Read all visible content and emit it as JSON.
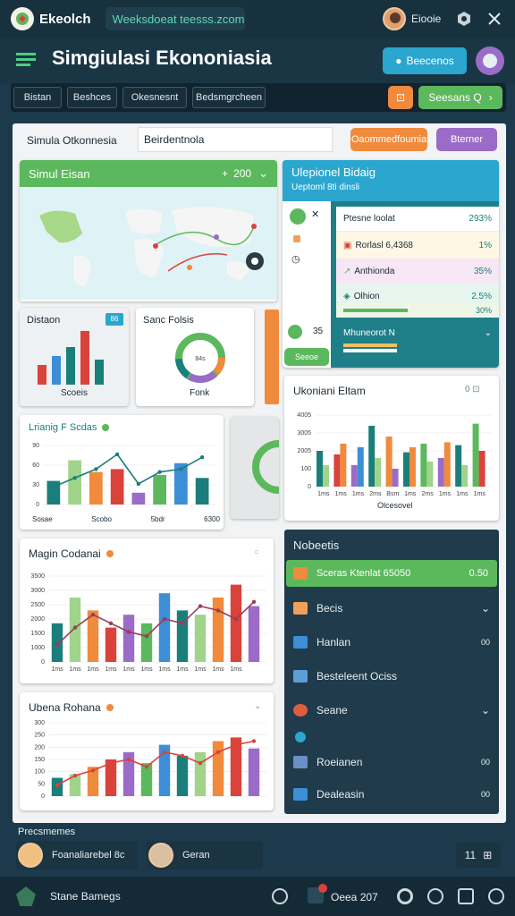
{
  "topbar": {
    "app_name": "Ekeolch",
    "url_text": "Weeksdoeat teesss.zcom",
    "user_name": "Eiooie"
  },
  "header": {
    "title": "Simgiulasi Ekononiasia",
    "btn_primary": "Beecenos",
    "nav_tabs": [
      "Bistan",
      "Beshces",
      "Okesnesnt",
      "Bedsmgrcheen"
    ],
    "nav_btn": "Seesans Q"
  },
  "sim": {
    "label": "Simula Otkonnesia",
    "input_value": "Beirdentnola",
    "btn_orange": "Oaommedfoumia",
    "btn_purple": "Bterner"
  },
  "map_card": {
    "title": "Simul Eisan",
    "value": "200"
  },
  "right_card": {
    "title": "Ulepionel Bidaig",
    "subtitle": "Ueptoml 8ti dinsli",
    "rows": [
      {
        "label": "Ptesne loolat",
        "value": "293%",
        "bg": "#ffffff"
      },
      {
        "label": "Rorlasl 6,4368",
        "value": "1%",
        "bg": "#fdf7e4"
      },
      {
        "label": "Anthionda",
        "value": "35%",
        "bg": "#f7e6f4"
      },
      {
        "label": "Olhion",
        "value": "2.5%",
        "bg": "#e6f5ee"
      }
    ],
    "extra_value": "30%",
    "count": "35",
    "green_btn": "Seeoe",
    "footer": "Mhuneorot N"
  },
  "small_cards": {
    "a_title": "Distaon",
    "a_badge": "86",
    "a_footer": "Scoeis",
    "b_title": "Sanc Folsis",
    "b_footer": "Fonk",
    "b_center": "84s"
  },
  "colors": {
    "teal": "#1a7f7a",
    "red": "#d9433b",
    "orange": "#f08a3c",
    "green": "#5cb85c",
    "purple": "#9b6cc7",
    "lightgreen": "#9fd48a",
    "blue": "#3c8ed6"
  },
  "chart_data": [
    {
      "type": "bar",
      "title": "Ukoniani Eltam",
      "categories": [
        "1ms",
        "1ms",
        "1ms",
        "2ms",
        "Bsm",
        "1ms",
        "2ms",
        "1ms",
        "1ms",
        "1ms"
      ],
      "series": [
        {
          "values": [
            50,
            45,
            30,
            85,
            70,
            48,
            60,
            40,
            58,
            88
          ]
        },
        {
          "values": [
            30,
            60,
            55,
            40,
            25,
            55,
            35,
            62,
            30,
            50
          ]
        }
      ],
      "y_ticks": [
        "0",
        "100",
        "2005",
        "3005",
        "4005"
      ],
      "xlabel": "Olcesovel"
    },
    {
      "type": "bar",
      "title": "Lrianig F Scdas",
      "categories": [
        "Sosae",
        "Scobo",
        "5bdr",
        "6300"
      ],
      "values": [
        40,
        75,
        55,
        60,
        20,
        50,
        70,
        45
      ],
      "line": [
        30,
        45,
        60,
        85,
        35,
        55,
        60,
        80
      ],
      "y_ticks": [
        "0",
        "30",
        "60",
        "90"
      ]
    },
    {
      "type": "bar",
      "title": "Magin Codanai",
      "categories": [
        "1ms",
        "1ms",
        "1ms",
        "1ms",
        "1ms",
        "1ms",
        "1ms",
        "1ms",
        "1ms",
        "1ms",
        "1ms"
      ],
      "values": [
        45,
        75,
        60,
        40,
        55,
        45,
        80,
        60,
        55,
        75,
        90,
        65
      ],
      "line": [
        20,
        40,
        55,
        45,
        35,
        30,
        50,
        45,
        65,
        60,
        50,
        70
      ],
      "y_ticks": [
        "0",
        "1000",
        "1500",
        "2000",
        "2500",
        "3000",
        "3500"
      ]
    },
    {
      "type": "bar",
      "title": "Ubena Rohana",
      "categories": [
        "1ms",
        "1ms",
        "1ms",
        "1ms",
        "1ms",
        "1ms",
        "1ms",
        "1ms",
        "1ms",
        "1ms",
        "1ms"
      ],
      "values": [
        25,
        30,
        40,
        50,
        60,
        45,
        70,
        55,
        60,
        75,
        80,
        65
      ],
      "line": [
        15,
        28,
        35,
        45,
        50,
        40,
        60,
        55,
        45,
        60,
        70,
        75
      ],
      "y_ticks": [
        "0",
        "50",
        "100",
        "150",
        "200",
        "250",
        "300"
      ]
    }
  ],
  "right_list": {
    "title": "Nobeetis",
    "items": [
      {
        "label": "Sceras Ktenlat 65050",
        "value": "0.50",
        "active": true,
        "icon_color": "#f08a3c"
      },
      {
        "label": "Becis",
        "value": "",
        "active": false,
        "icon_color": "#f0a05a"
      },
      {
        "label": "Hanlan",
        "value": "00",
        "active": false,
        "icon_color": "#3c8ed6"
      },
      {
        "label": "Besteleent Ociss",
        "value": "",
        "active": false,
        "icon_color": "#5b9fd6"
      },
      {
        "label": "Seane",
        "value": "",
        "active": false,
        "icon_color": "#e05e3c"
      },
      {
        "label": "Roeianen",
        "value": "00",
        "active": false,
        "icon_color": "#6a8fc9"
      },
      {
        "label": "Dealeasin",
        "value": "00",
        "active": false,
        "icon_color": "#3c8ed6"
      }
    ]
  },
  "bottom": {
    "section_label": "Precsmemes",
    "user1": "Foanaliarebel 8c",
    "user2": "Geran",
    "counter": "11",
    "footer_label": "Stane Bamegs",
    "footer_center": "Oeea 207"
  }
}
